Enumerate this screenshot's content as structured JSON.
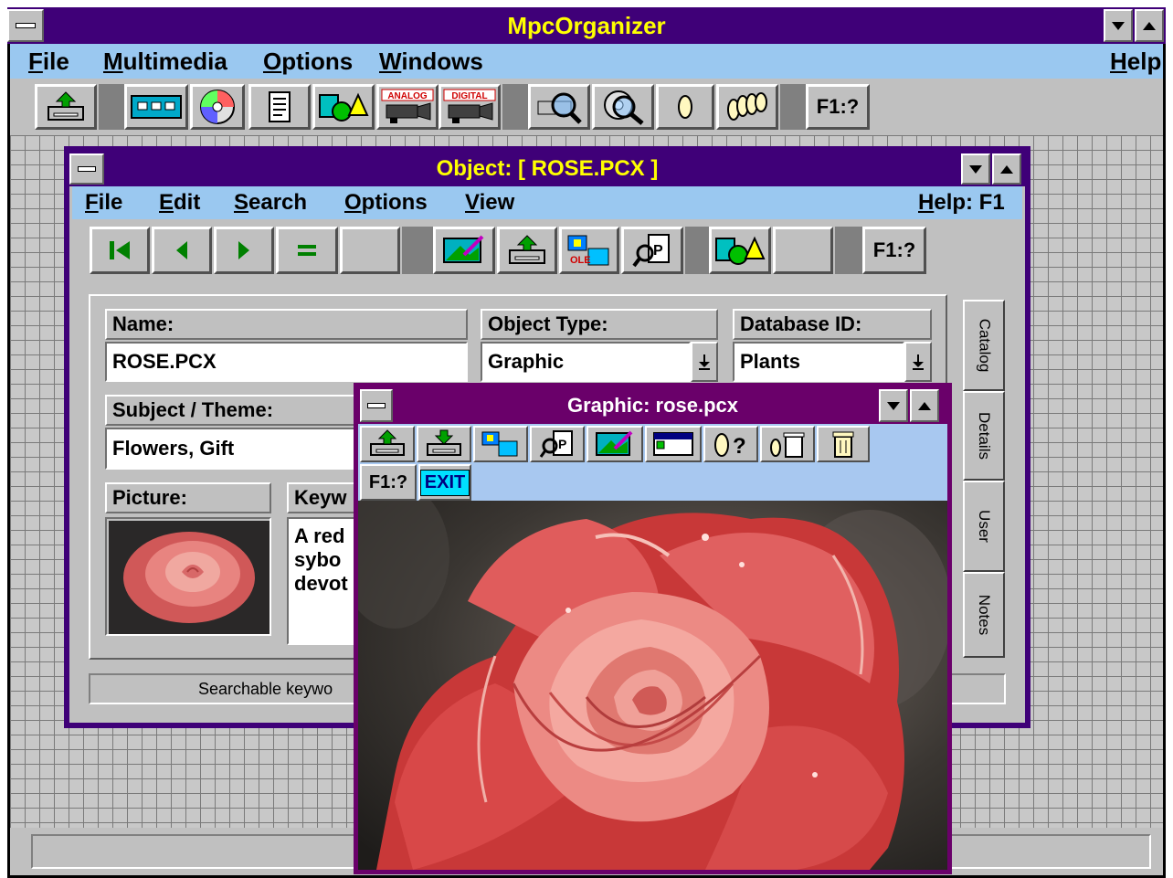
{
  "app": {
    "title": "MpcOrganizer",
    "menu": [
      "File",
      "Multimedia",
      "Options",
      "Windows"
    ],
    "help_label": "Help",
    "toolbar_help_label": "F1:?"
  },
  "object_window": {
    "title": "Object: [ ROSE.PCX ]",
    "menu": [
      "File",
      "Edit",
      "Search",
      "Options",
      "View"
    ],
    "help_label": "Help: F1",
    "toolbar_help_label": "F1:?",
    "form": {
      "name_label": "Name:",
      "name_value": "ROSE.PCX",
      "object_type_label": "Object Type:",
      "object_type_value": "Graphic",
      "database_id_label": "Database ID:",
      "database_id_value": "Plants",
      "subject_label": "Subject / Theme:",
      "subject_value": "Flowers, Gift",
      "picture_label": "Picture:",
      "keywords_label": "Keyw",
      "keywords_lines": [
        "A red",
        "sybo",
        "devot"
      ]
    },
    "tabs": [
      "Catalog",
      "Details",
      "User",
      "Notes"
    ],
    "status_text": "Searchable keywo"
  },
  "graphic_window": {
    "title": "Graphic: rose.pcx",
    "help_label": "F1:?",
    "exit_label": "EXIT"
  },
  "colors": {
    "title_bar": "#3f0078",
    "title_text": "#ffff00",
    "menu_bar": "#9ac8f0",
    "graphic_frame": "#6a006a",
    "graphic_toolbar": "#a8c8f0"
  }
}
